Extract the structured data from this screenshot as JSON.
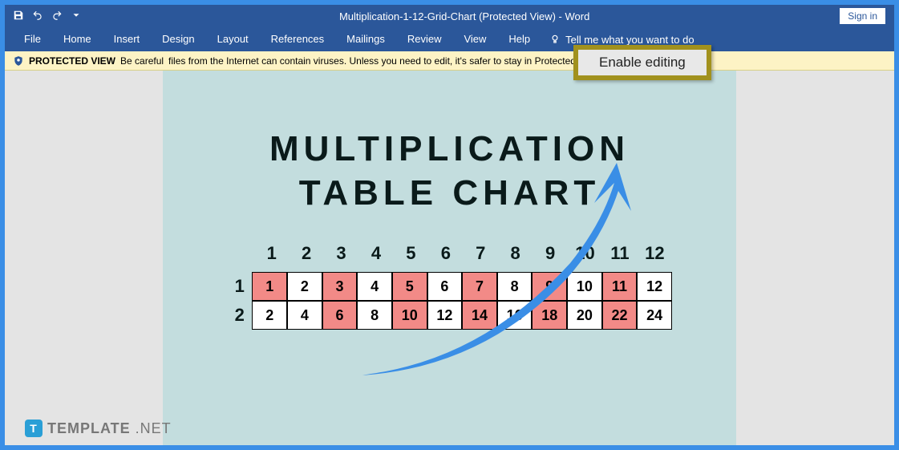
{
  "title_bar": {
    "title": "Multiplication-1-12-Grid-Chart (Protected View) - Word",
    "signin": "Sign in"
  },
  "ribbon": {
    "tabs": [
      "File",
      "Home",
      "Insert",
      "Design",
      "Layout",
      "References",
      "Mailings",
      "Review",
      "View",
      "Help"
    ],
    "tellme": "Tell me what you want to do"
  },
  "protected_view": {
    "label": "PROTECTED VIEW",
    "msg1": "Be careful",
    "msg2": "files from the Internet can contain viruses. Unless you need to edit, it's safer to stay in Protected View.",
    "enable_btn": "Enable editing"
  },
  "document": {
    "title_line1": "MULTIPLICATION",
    "title_line2": "TABLE  CHART"
  },
  "chart_data": {
    "type": "table",
    "title": "Multiplication Table Chart",
    "columns": [
      "1",
      "2",
      "3",
      "4",
      "5",
      "6",
      "7",
      "8",
      "9",
      "10",
      "11",
      "12"
    ],
    "rows": [
      {
        "label": "1",
        "cells": [
          "1",
          "2",
          "3",
          "4",
          "5",
          "6",
          "7",
          "8",
          "9",
          "10",
          "11",
          "12"
        ],
        "highlight": [
          0,
          2,
          4,
          6,
          8,
          10
        ]
      },
      {
        "label": "2",
        "cells": [
          "2",
          "4",
          "6",
          "8",
          "10",
          "12",
          "14",
          "16",
          "18",
          "20",
          "22",
          "24"
        ],
        "highlight": [
          2,
          4,
          6,
          8,
          10
        ]
      }
    ]
  },
  "footer": {
    "brand": "TEMPLATE",
    "suffix": ".NET",
    "t": "T"
  }
}
